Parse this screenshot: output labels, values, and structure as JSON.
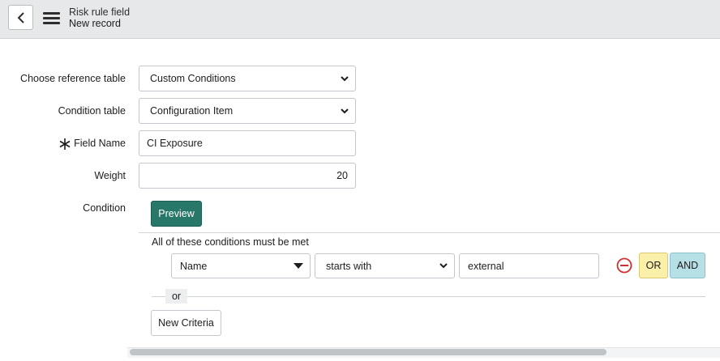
{
  "header": {
    "title": "Risk rule field",
    "subtitle": "New record",
    "back_icon": "chevron-left-icon",
    "menu_icon": "hamburger-menu-icon"
  },
  "form": {
    "reference_table": {
      "label": "Choose reference table",
      "value": "Custom Conditions"
    },
    "condition_table": {
      "label": "Condition table",
      "value": "Configuration Item"
    },
    "field_name": {
      "label": "Field Name",
      "value": "CI Exposure",
      "required_icon": "asterisk-icon"
    },
    "weight": {
      "label": "Weight",
      "value": "20"
    },
    "condition": {
      "label": "Condition"
    }
  },
  "condition_builder": {
    "preview_label": "Preview",
    "group_title": "All of these conditions must be met",
    "row": {
      "field": "Name",
      "operator": "starts with",
      "value": "external"
    },
    "or_label": "OR",
    "and_label": "AND",
    "or_separator": "or",
    "new_criteria_label": "New Criteria"
  },
  "colors": {
    "preview_bg": "#28786a",
    "or_bg": "#fbf0a9",
    "and_bg": "#b7dfe6",
    "remove_icon": "#d32f2f"
  }
}
